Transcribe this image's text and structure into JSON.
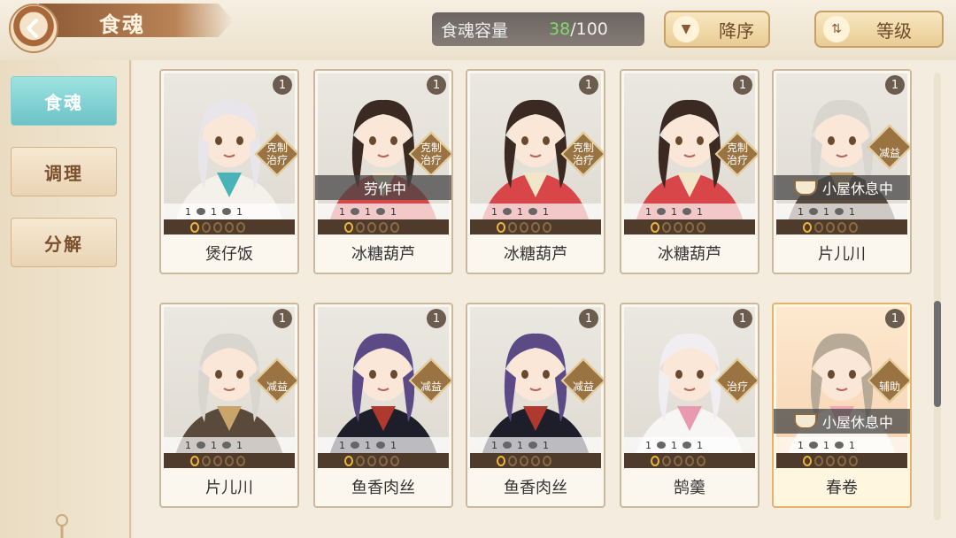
{
  "header": {
    "title": "食魂",
    "capacity_label": "食魂容量",
    "capacity_current": "38",
    "capacity_max": "/100",
    "sort_order_label": "降序",
    "sort_key_label": "等级"
  },
  "sidebar": {
    "items": [
      {
        "label": "食魂",
        "active": true
      },
      {
        "label": "调理",
        "active": false
      },
      {
        "label": "分解",
        "active": false
      }
    ]
  },
  "cards": [
    {
      "name": "煲仔饭",
      "level": "1",
      "role": "克制\n治疗",
      "status": "",
      "stat1": "1",
      "stat2": "1",
      "stat3": "1",
      "stars": 1,
      "hair": "#e8e6ea",
      "outfit": "#f4f1ea",
      "accent": "#4ab3b8"
    },
    {
      "name": "冰糖葫芦",
      "level": "1",
      "role": "克制\n治疗",
      "status": "劳作中",
      "stat1": "1",
      "stat2": "1",
      "stat3": "1",
      "stars": 1,
      "hair": "#3b2a22",
      "outfit": "#d8464a",
      "accent": "#f3e5c8"
    },
    {
      "name": "冰糖葫芦",
      "level": "1",
      "role": "克制\n治疗",
      "status": "",
      "stat1": "1",
      "stat2": "1",
      "stat3": "1",
      "stars": 1,
      "hair": "#3b2a22",
      "outfit": "#d8464a",
      "accent": "#f3e5c8"
    },
    {
      "name": "冰糖葫芦",
      "level": "1",
      "role": "克制\n治疗",
      "status": "",
      "stat1": "1",
      "stat2": "1",
      "stat3": "1",
      "stars": 1,
      "hair": "#3b2a22",
      "outfit": "#d8464a",
      "accent": "#f3e5c8"
    },
    {
      "name": "片儿川",
      "level": "1",
      "role": "减益",
      "status": "小屋休息中",
      "stat1": "1",
      "stat2": "1",
      "stat3": "1",
      "stars": 1,
      "hair": "#d9d6d0",
      "outfit": "#5a4a3c",
      "accent": "#c9a56b"
    },
    {
      "name": "片儿川",
      "level": "1",
      "role": "减益",
      "status": "",
      "stat1": "1",
      "stat2": "1",
      "stat3": "1",
      "stars": 1,
      "hair": "#d9d6d0",
      "outfit": "#5a4a3c",
      "accent": "#c9a56b"
    },
    {
      "name": "鱼香肉丝",
      "level": "1",
      "role": "减益",
      "status": "",
      "stat1": "1",
      "stat2": "1",
      "stat3": "1",
      "stars": 1,
      "hair": "#5b4a86",
      "outfit": "#1e1d2a",
      "accent": "#b0392f"
    },
    {
      "name": "鱼香肉丝",
      "level": "1",
      "role": "减益",
      "status": "",
      "stat1": "1",
      "stat2": "1",
      "stat3": "1",
      "stars": 1,
      "hair": "#5b4a86",
      "outfit": "#1e1d2a",
      "accent": "#b0392f"
    },
    {
      "name": "鹄羹",
      "level": "1",
      "role": "治疗",
      "status": "",
      "stat1": "1",
      "stat2": "1",
      "stat3": "1",
      "stars": 1,
      "hair": "#f0eef0",
      "outfit": "#f7f6f4",
      "accent": "#e89ab0"
    },
    {
      "name": "春卷",
      "level": "1",
      "role": "辅助",
      "status": "小屋休息中",
      "stat1": "1",
      "stat2": "1",
      "stat3": "1",
      "stars": 1,
      "hair": "#b7ab98",
      "outfit": "#fbf6ec",
      "accent": "#f2a9b6",
      "gold": true
    }
  ]
}
